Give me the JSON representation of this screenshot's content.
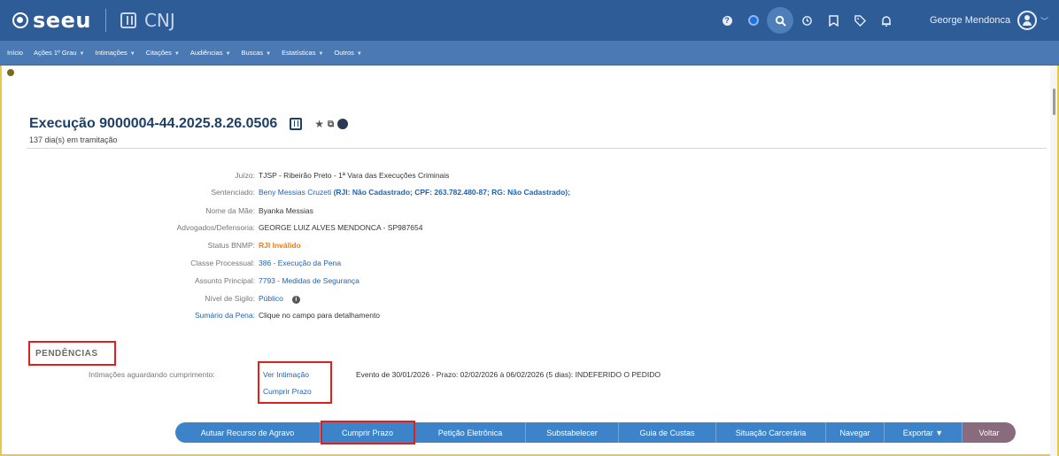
{
  "header": {
    "brand": "seeu",
    "org": "CNJ",
    "user_name": "George Mendonca",
    "icons": [
      "help-icon",
      "theme-toggle-icon",
      "search-icon",
      "history-icon",
      "bookmark-icon",
      "tag-icon",
      "bell-icon"
    ]
  },
  "menu": [
    {
      "label": "Início",
      "caret": false
    },
    {
      "label": "Ações 1º Grau",
      "caret": true
    },
    {
      "label": "Intimações",
      "caret": true
    },
    {
      "label": "Citações",
      "caret": true
    },
    {
      "label": "Audiências",
      "caret": true
    },
    {
      "label": "Buscas",
      "caret": true
    },
    {
      "label": "Estatísticas",
      "caret": true
    },
    {
      "label": "Outros",
      "caret": true
    }
  ],
  "process": {
    "title": "Execução 9000004-44.2025.8.26.0506",
    "subtitle": "137 dia(s) em tramitação"
  },
  "fields": {
    "juizo_label": "Juízo:",
    "juizo_value": "TJSP - Ribeirão Preto - 1ª Vara das Execuções Criminais",
    "sentenciado_label": "Sentenciado:",
    "sentenciado_name": "Beny Messias Cruzeti",
    "sentenciado_docs": "(RJI: Não Cadastrado; CPF: 263.782.480-87; RG: Não Cadastrado);",
    "mae_label": "Nome da Mãe:",
    "mae_value": "Byanka Messias",
    "advogados_label": "Advogados/Defensoria:",
    "advogados_value": "GEORGE LUIZ ALVES MENDONCA - SP987654",
    "bnmp_label": "Status BNMP:",
    "bnmp_value": "RJI Inválido",
    "classe_label": "Classe Processual:",
    "classe_value": "386 - Execução da Pena",
    "assunto_label": "Assunto Principal:",
    "assunto_value": "7793 - Medidas de Segurança",
    "sigilo_label": "Nível de Sigilo:",
    "sigilo_value": "Público",
    "sumario_label": "Sumário da Pena:",
    "sumario_value": "Clique no campo para detalhamento"
  },
  "pendencias": {
    "title": "PENDÊNCIAS",
    "intimacoes_label": "Intimações aguardando cumprimento:",
    "link_ver": "Ver Intimação",
    "link_cumprir": "Cumprir Prazo",
    "evento": "Evento de 30/01/2026 - Prazo: 02/02/2026 à 06/02/2026 (5 dias): INDEFERIDO O PEDIDO"
  },
  "actions": [
    "Autuar Recurso de Agravo",
    "Cumprir Prazo",
    "Petição Eletrônica",
    "Substabelecer",
    "Guia de Custas",
    "Situação Carcerária",
    "Navegar",
    "Exportar ▼",
    "Voltar"
  ]
}
